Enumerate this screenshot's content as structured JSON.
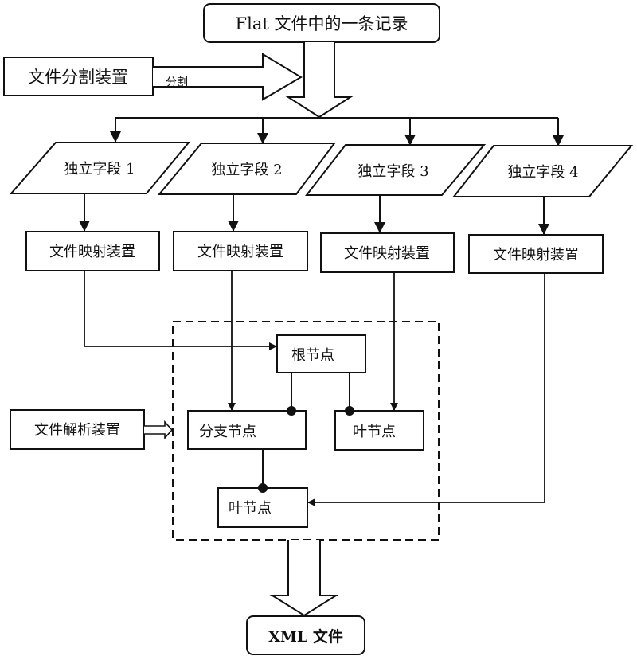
{
  "diagram": {
    "record": {
      "label": "Flat 文件中的一条记录"
    },
    "splitter": {
      "label": "文件分割装置",
      "arrow_label": "分割"
    },
    "fields": [
      {
        "label": "独立字段 1"
      },
      {
        "label": "独立字段 2"
      },
      {
        "label": "独立字段 3"
      },
      {
        "label": "独立字段 4"
      }
    ],
    "mappers": [
      {
        "label": "文件映射装置"
      },
      {
        "label": "文件映射装置"
      },
      {
        "label": "文件映射装置"
      },
      {
        "label": "文件映射装置"
      }
    ],
    "parser": {
      "label": "文件解析装置"
    },
    "tree": {
      "root": {
        "label": "根节点"
      },
      "branch": {
        "label": "分支节点"
      },
      "leaf_right": {
        "label": "叶节点"
      },
      "leaf_lower": {
        "label": "叶节点"
      }
    },
    "output": {
      "label": "XML 文件"
    },
    "colors": {
      "stroke": "#111111",
      "fill": "#ffffff"
    }
  }
}
